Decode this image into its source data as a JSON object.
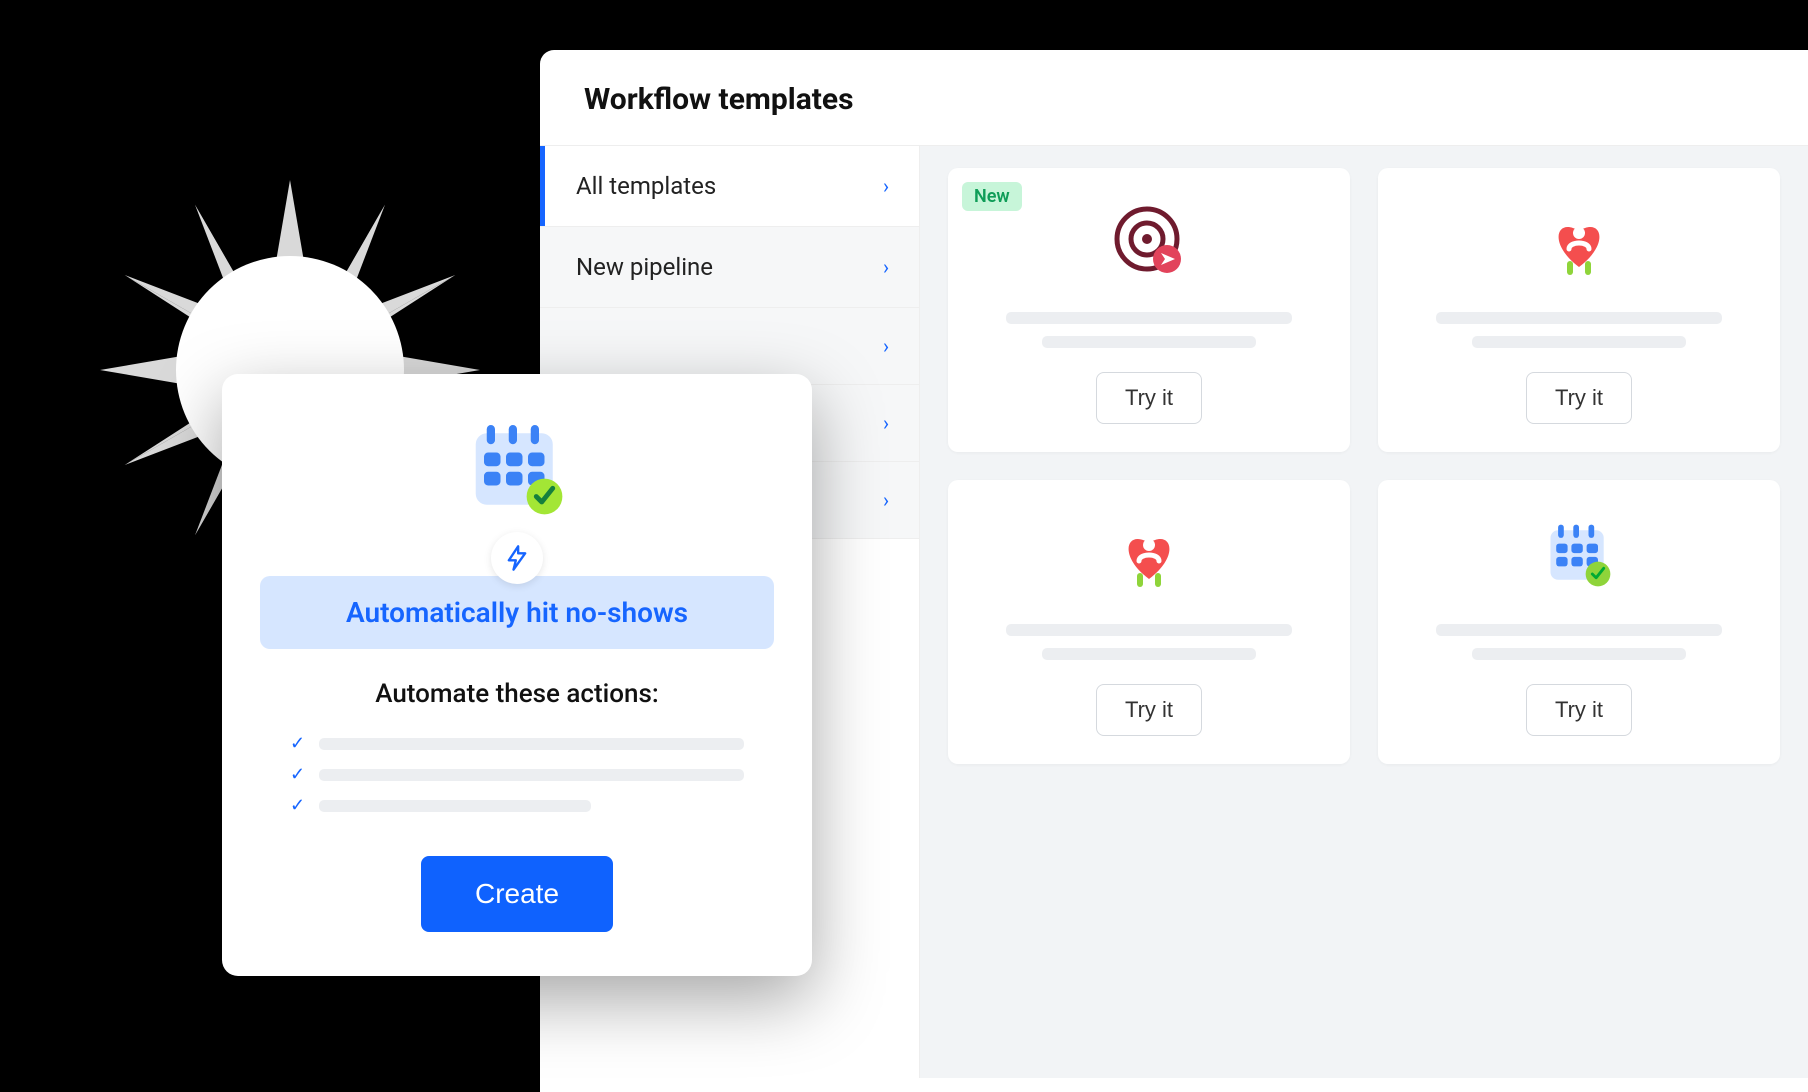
{
  "panel": {
    "title": "Workflow templates",
    "sidebar": [
      {
        "label": "All templates",
        "active": true
      },
      {
        "label": "New pipeline",
        "active": false
      },
      {
        "label": "",
        "active": false
      },
      {
        "label": "",
        "active": false
      },
      {
        "label": "",
        "active": false
      }
    ]
  },
  "templates": [
    {
      "icon": "target",
      "badge": "New",
      "cta": "Try it"
    },
    {
      "icon": "heart-person",
      "badge": null,
      "cta": "Try it"
    },
    {
      "icon": "heart-person",
      "badge": null,
      "cta": "Try it"
    },
    {
      "icon": "calendar-check",
      "badge": null,
      "cta": "Try it"
    }
  ],
  "popup": {
    "icon": "calendar-check",
    "title": "Automatically hit no-shows",
    "subtitle": "Automate these actions:",
    "cta": "Create"
  },
  "colors": {
    "primary": "#1665ff",
    "primaryButton": "#0f62fe",
    "badgeBg": "#c7f5d9",
    "badgeText": "#0f9d58",
    "pillBg": "#d6e6ff"
  }
}
